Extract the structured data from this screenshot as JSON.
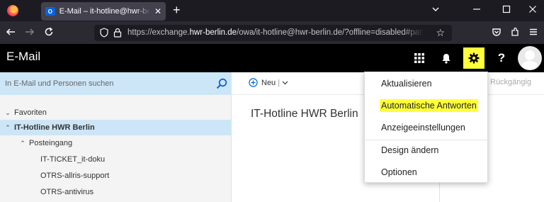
{
  "browser": {
    "tab_title": "E-Mail – it-hotline@hwr-berlin.de",
    "tab_icon_label": "O",
    "url_prefix": "https://exchange.",
    "url_domain": "hwr-berlin.de",
    "url_rest": "/owa/it-hotline@hwr-berlin.de/?offline=disabled#path=/mail"
  },
  "app": {
    "title": "E-Mail"
  },
  "search": {
    "placeholder": "In E-Mail und Personen suchen"
  },
  "commands": {
    "new_label": "Neu",
    "undo_label": "Rückgängig"
  },
  "folders": {
    "items": [
      {
        "label": "Favoriten"
      },
      {
        "label": "IT-Hotline HWR Berlin"
      },
      {
        "label": "Posteingang"
      },
      {
        "label": "IT-TICKET_it-doku"
      },
      {
        "label": "OTRS-allris-support"
      },
      {
        "label": "OTRS-antivirus"
      }
    ]
  },
  "main": {
    "title": "IT-Hotline HWR Berlin"
  },
  "settings_menu": {
    "items": [
      {
        "label": "Aktualisieren"
      },
      {
        "label": "Automatische Antworten"
      },
      {
        "label": "Anzeigeeinstellungen"
      },
      {
        "label": "Design ändern"
      },
      {
        "label": "Optionen"
      }
    ]
  },
  "colors": {
    "highlight": "#ffff3a",
    "selection": "#cde6f7",
    "header_bg": "#000000",
    "accent": "#0078d4"
  }
}
